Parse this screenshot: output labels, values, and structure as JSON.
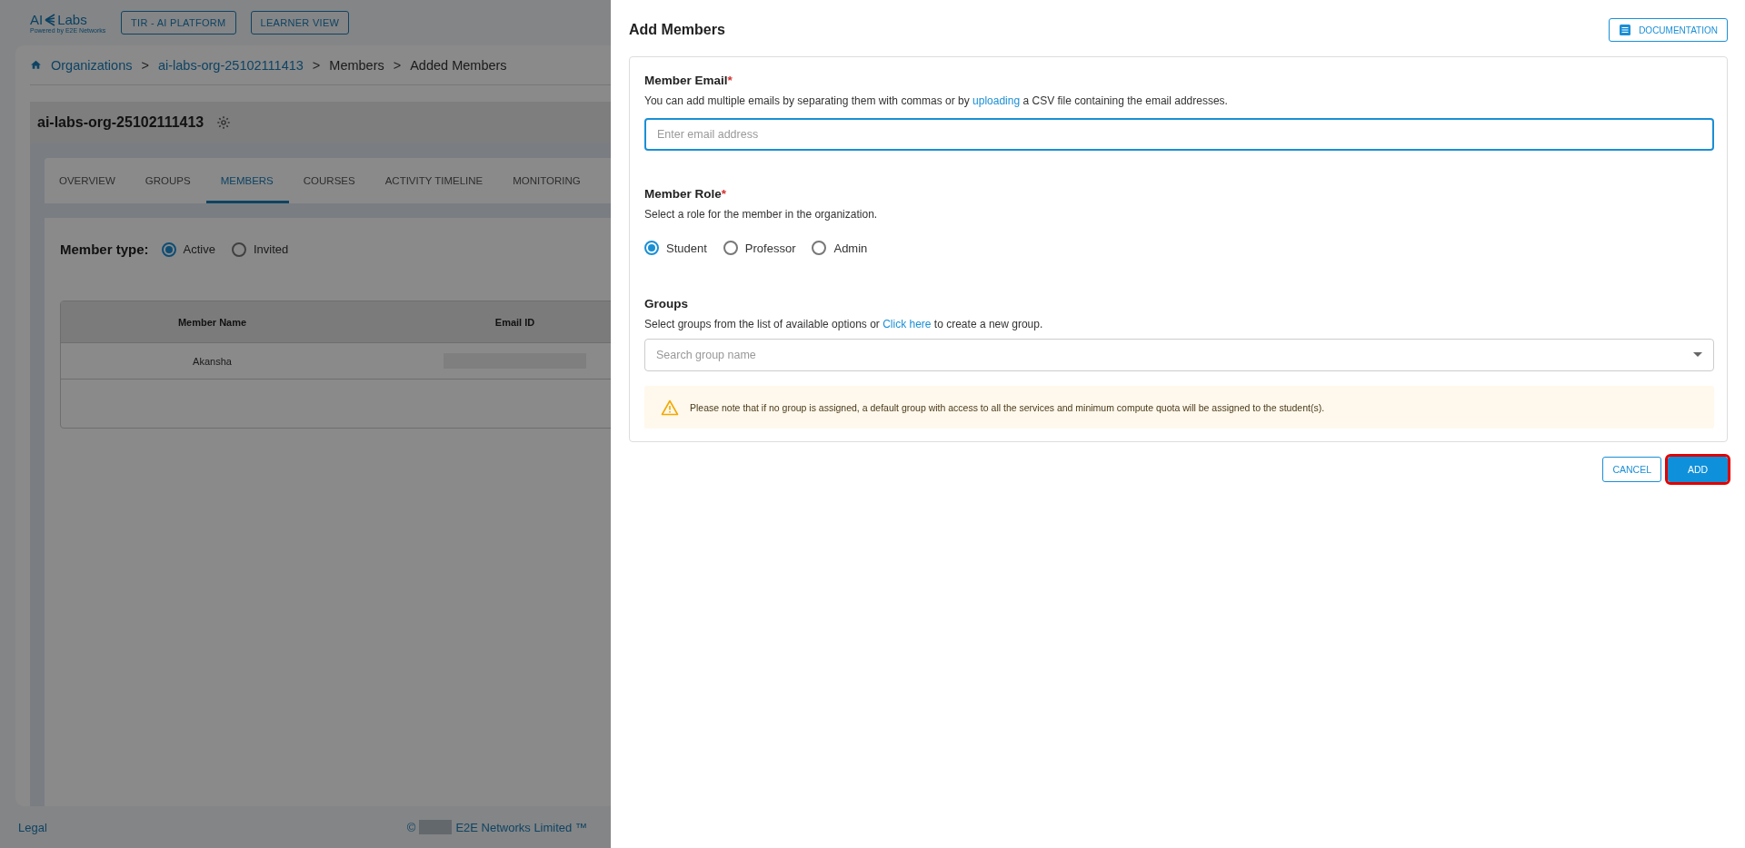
{
  "header": {
    "logo": {
      "left": "AI",
      "right": "Labs",
      "tagline": "Powered by E2E Networks"
    },
    "buttons": [
      "TIR - AI PLATFORM",
      "LEARNER VIEW"
    ]
  },
  "breadcrumb_separator": ">",
  "breadcrumb": [
    {
      "label": "Organizations",
      "link": true
    },
    {
      "label": "ai-labs-org-25102111413",
      "link": true
    },
    {
      "label": "Members",
      "link": false
    },
    {
      "label": "Added Members",
      "link": false
    }
  ],
  "organization": {
    "title": "ai-labs-org-25102111413"
  },
  "tabs": [
    {
      "label": "OVERVIEW",
      "selected": false
    },
    {
      "label": "GROUPS",
      "selected": false
    },
    {
      "label": "MEMBERS",
      "selected": true
    },
    {
      "label": "COURSES",
      "selected": false
    },
    {
      "label": "ACTIVITY TIMELINE",
      "selected": false
    },
    {
      "label": "MONITORING",
      "selected": false
    }
  ],
  "member_type": {
    "label": "Member type:",
    "options": [
      {
        "label": "Active",
        "selected": true
      },
      {
        "label": "Invited",
        "selected": false
      }
    ]
  },
  "table": {
    "columns": [
      "Member Name",
      "Email ID"
    ],
    "rows": [
      {
        "name": "Akansha",
        "email_redacted": true
      }
    ]
  },
  "footer": {
    "legal": "Legal",
    "copyright_symbol": "©",
    "company": "E2E Networks Limited ™"
  },
  "drawer": {
    "title": "Add Members",
    "documentation_button": "DOCUMENTATION",
    "email": {
      "label": "Member Email",
      "required_mark": "*",
      "help_before": "You can add multiple emails by separating them with commas or by",
      "help_link": "uploading",
      "help_after": "a CSV file containing the email addresses.",
      "placeholder": "Enter email address",
      "focused": true
    },
    "role": {
      "label": "Member Role",
      "required_mark": "*",
      "help": "Select a role for the member in the organization.",
      "options": [
        {
          "label": "Student",
          "selected": true
        },
        {
          "label": "Professor",
          "selected": false
        },
        {
          "label": "Admin",
          "selected": false
        }
      ]
    },
    "groups": {
      "label": "Groups",
      "help_before": "Select groups from the list of available options or",
      "help_link": "Click here",
      "help_after": "to create a new group.",
      "placeholder": "Search group name",
      "warning": "Please note that if no group is assigned, a default group with access to all the services and minimum compute quota will be assigned to the student(s)."
    },
    "actions": [
      {
        "label": "CANCEL",
        "kind": "outlined",
        "highlighted": false
      },
      {
        "label": "ADD",
        "kind": "filled",
        "highlighted": true
      }
    ]
  }
}
